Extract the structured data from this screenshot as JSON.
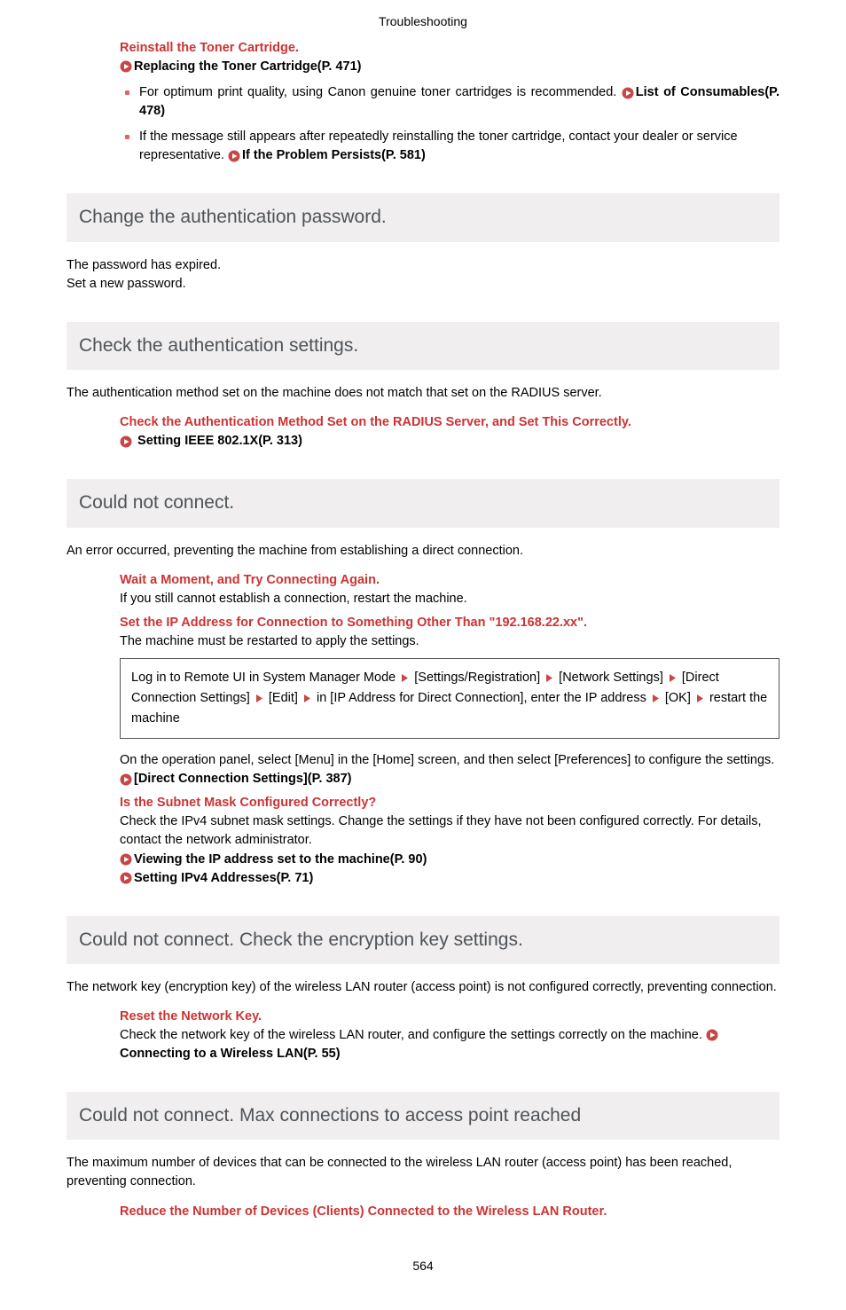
{
  "header": "Troubleshooting",
  "top": {
    "h1": "Reinstall the Toner Cartridge.",
    "link1": "Replacing the Toner Cartridge(P. 471)",
    "b1a": "For optimum print quality, using Canon genuine toner cartridges is recommended.  ",
    "b1link": "List of Consumables(P. 478)",
    "b2a": "If the message still appears after repeatedly reinstalling the toner cartridge, contact your dealer or service representative. ",
    "b2link": "If the Problem Persists(P. 581)"
  },
  "s1": {
    "title": "Change the authentication password.",
    "p1": "The password has expired.",
    "p2": "Set a new password."
  },
  "s2": {
    "title": "Check the authentication settings.",
    "p1": "The authentication method set on the machine does not match that set on the RADIUS server.",
    "h1": "Check the Authentication Method Set on the RADIUS Server, and Set This Correctly.",
    "link1": " Setting IEEE 802.1X(P. 313)"
  },
  "s3": {
    "title": "Could not connect.",
    "p1": "An error occurred, preventing the machine from establishing a direct connection.",
    "h1": "Wait a Moment, and Try Connecting Again.",
    "h1p": "If you still cannot establish a connection, restart the machine.",
    "h2": "Set the IP Address for Connection to Something Other Than \"192.168.22.xx\".",
    "h2p": "The machine must be restarted to apply the settings.",
    "box": {
      "t1": "Log in to Remote UI in System Manager Mode ",
      "t2": " [Settings/Registration] ",
      "t3": " [Network Settings] ",
      "t4": " [Direct Connection Settings] ",
      "t5": " [Edit] ",
      "t6": " in [IP Address for Direct Connection], enter the IP address ",
      "t7": " [OK] ",
      "t8": " restart the machine"
    },
    "p2a": "On the operation panel, select [Menu] in the [Home] screen, and then select [Preferences] to configure the settings. ",
    "p2link": "[Direct Connection Settings](P. 387)",
    "h3": "Is the Subnet Mask Configured Correctly?",
    "h3p": "Check the IPv4 subnet mask settings. Change the settings if they have not been configured correctly. For details, contact the network administrator.",
    "link3a": "Viewing the IP address set to the machine(P. 90)",
    "link3b": "Setting IPv4 Addresses(P. 71)"
  },
  "s4": {
    "title": "Could not connect. Check the encryption key settings.",
    "p1": "The network key (encryption key) of the wireless LAN router (access point) is not configured correctly, preventing connection.",
    "h1": "Reset the Network Key.",
    "h1p": "Check the network key of the wireless LAN router, and configure the settings correctly on the machine. ",
    "link1": "Connecting to a Wireless LAN(P. 55)"
  },
  "s5": {
    "title": "Could not connect. Max connections to access point reached",
    "p1": "The maximum number of devices that can be connected to the wireless LAN router (access point) has been reached, preventing connection.",
    "h1": "Reduce the Number of Devices (Clients) Connected to the Wireless LAN Router."
  },
  "pagenum": "564"
}
